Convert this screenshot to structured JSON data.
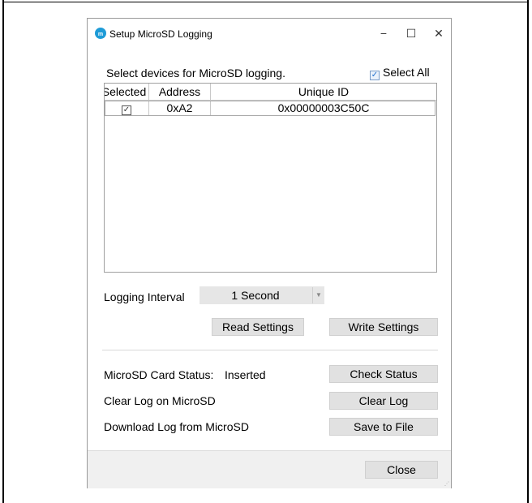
{
  "window": {
    "title": "Setup MicroSD Logging",
    "controls": {
      "minimize": "−",
      "maximize": "☐",
      "close": "✕"
    }
  },
  "devices": {
    "prompt": "Select devices for MicroSD logging.",
    "select_all_label": "Select All",
    "select_all_checked": true,
    "columns": [
      "Selected",
      "Address",
      "Unique ID"
    ],
    "rows": [
      {
        "selected": true,
        "address": "0xA2",
        "unique_id": "0x00000003C50C"
      }
    ]
  },
  "logging": {
    "interval_label": "Logging Interval",
    "interval_value": "1 Second",
    "read_settings": "Read Settings",
    "write_settings": "Write Settings"
  },
  "card": {
    "status_label": "MicroSD Card Status:",
    "status_value": "Inserted",
    "check_status": "Check Status",
    "clear_log_label": "Clear Log on MicroSD",
    "clear_log_button": "Clear Log",
    "download_label": "Download Log from MicroSD",
    "save_button": "Save to File"
  },
  "footer": {
    "close_button": "Close"
  },
  "colors": {
    "accent": "#1e6fcf",
    "button_bg": "#e1e1e1",
    "footer_bg": "#f0f0f0"
  }
}
